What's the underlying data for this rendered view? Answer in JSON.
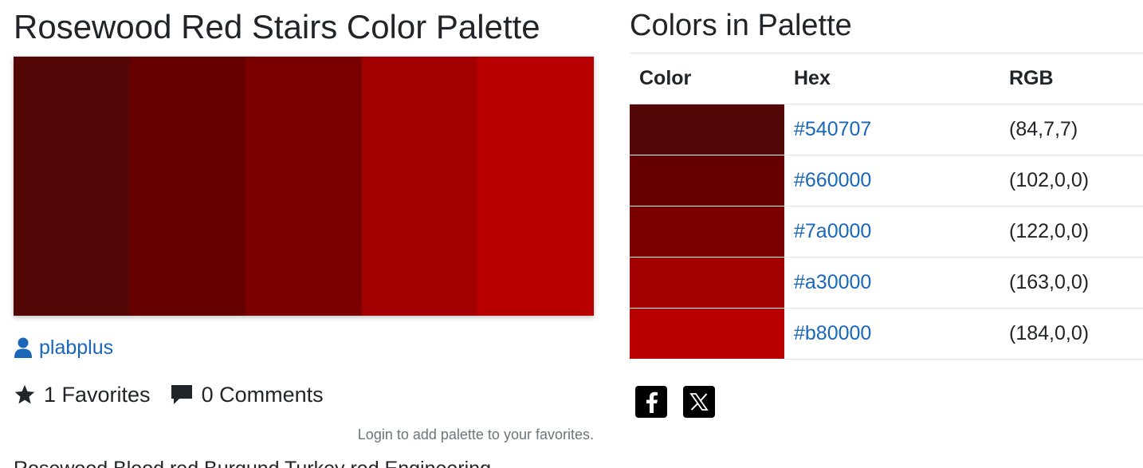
{
  "palette": {
    "title": "Rosewood Red Stairs Color Palette",
    "swatches": [
      "#540707",
      "#660000",
      "#7a0000",
      "#a30000",
      "#b80000"
    ]
  },
  "author": {
    "icon": "user-icon",
    "name": "plabplus"
  },
  "stats": {
    "favorites_icon": "star-icon",
    "favorites_label": "1 Favorites",
    "comments_icon": "comment-icon",
    "comments_label": "0 Comments"
  },
  "login_note": "Login to add palette to your favorites.",
  "tags_partial": "Rosewood  Blood red  Burgund  Turkey red  Engineering",
  "colors_section": {
    "title": "Colors in Palette",
    "headers": {
      "color": "Color",
      "hex": "Hex",
      "rgb": "RGB"
    },
    "rows": [
      {
        "swatch": "#540707",
        "hex": "#540707",
        "rgb": "(84,7,7)"
      },
      {
        "swatch": "#660000",
        "hex": "#660000",
        "rgb": "(102,0,0)"
      },
      {
        "swatch": "#7a0000",
        "hex": "#7a0000",
        "rgb": "(122,0,0)"
      },
      {
        "swatch": "#a30000",
        "hex": "#a30000",
        "rgb": "(163,0,0)"
      },
      {
        "swatch": "#b80000",
        "hex": "#b80000",
        "rgb": "(184,0,0)"
      }
    ]
  },
  "share": {
    "facebook_icon": "facebook-icon",
    "x_icon": "x-twitter-icon"
  },
  "colors": {
    "link": "#1a66b8",
    "text": "#212529",
    "muted": "#6c757d",
    "divider": "#dee2e6"
  }
}
